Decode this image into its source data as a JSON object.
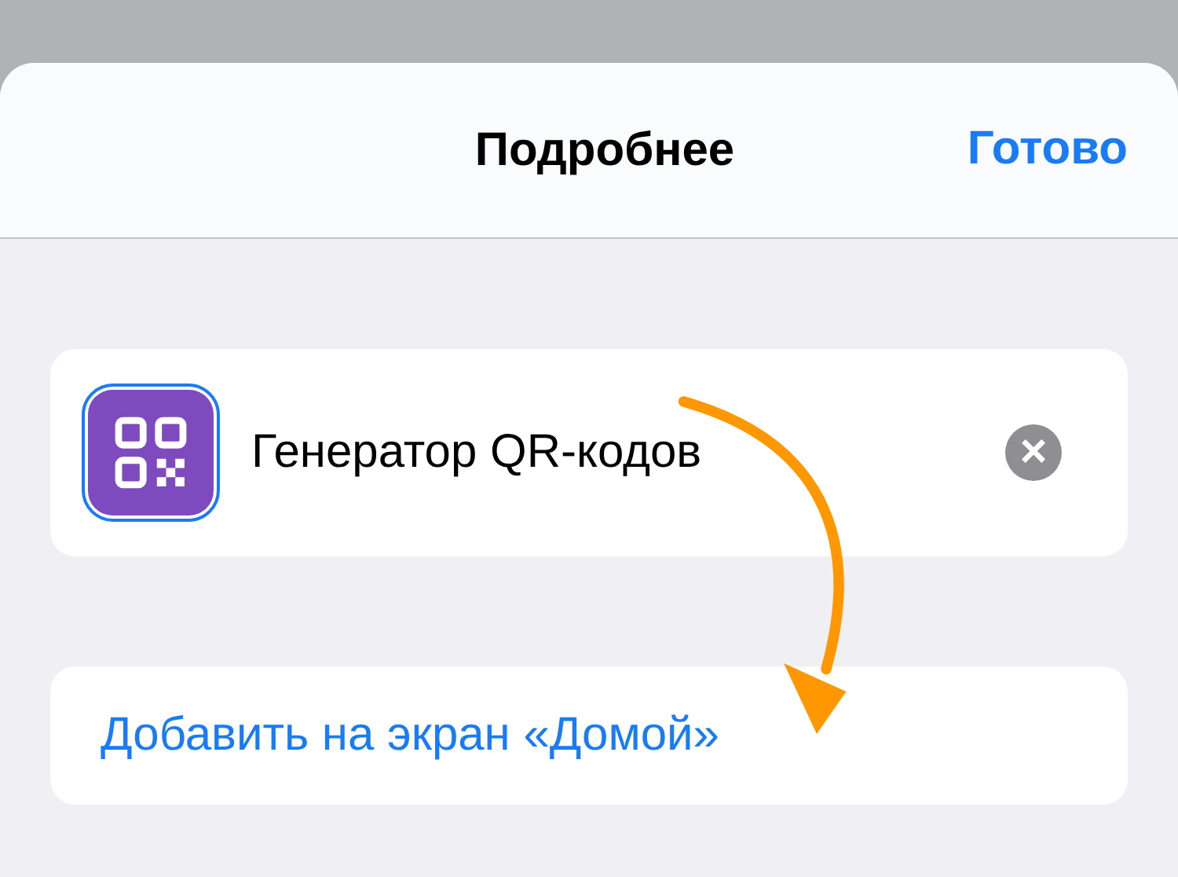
{
  "header": {
    "title": "Подробнее",
    "done": "Готово"
  },
  "app": {
    "name": "Генератор QR-кодов",
    "icon_selected": true,
    "clear": "×"
  },
  "action": {
    "label": "Добавить на экран «Домой»"
  }
}
